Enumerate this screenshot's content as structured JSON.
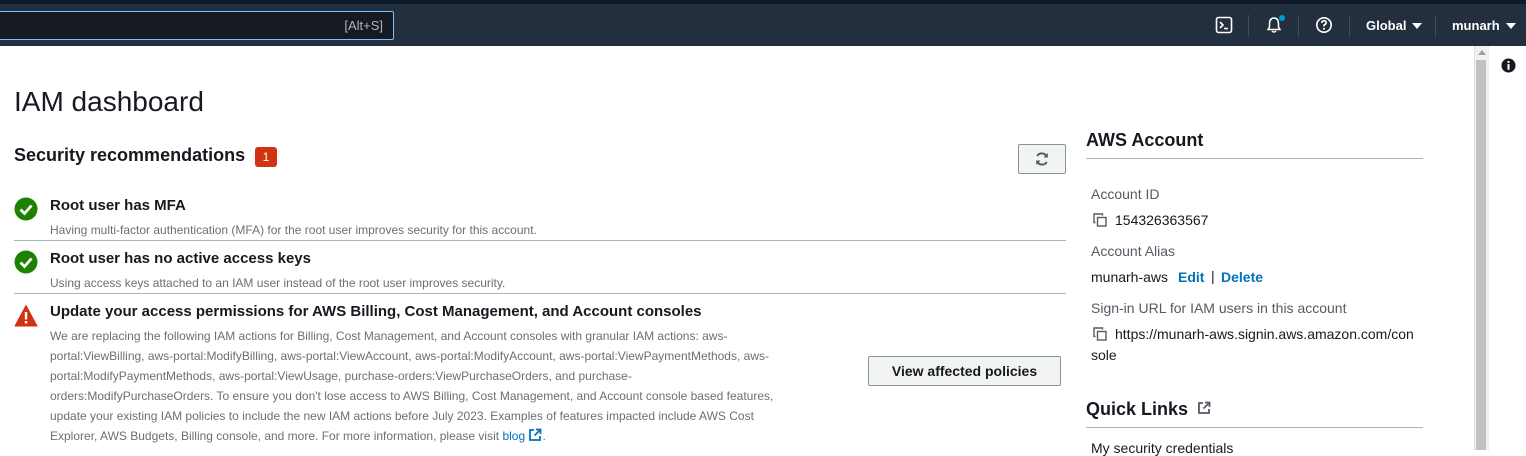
{
  "topnav": {
    "search_shortcut": "[Alt+S]",
    "region": "Global",
    "user": "munarh",
    "icons": [
      "cloudshell-icon",
      "bell-icon",
      "help-icon"
    ]
  },
  "page": {
    "title": "IAM dashboard"
  },
  "security": {
    "title": "Security recommendations",
    "badge_count": "1",
    "items": [
      {
        "status": "success",
        "title": "Root user has MFA",
        "description": "Having multi-factor authentication (MFA) for the root user improves security for this account."
      },
      {
        "status": "success",
        "title": "Root user has no active access keys",
        "description": "Using access keys attached to an IAM user instead of the root user improves security."
      },
      {
        "status": "warning",
        "title": "Update your access permissions for AWS Billing, Cost Management, and Account consoles",
        "description_lines": [
          "We are replacing the following IAM actions for Billing, Cost Management, and Account consoles with granular IAM actions: aws-",
          "portal:ViewBilling, aws-portal:ModifyBilling, aws-portal:ViewAccount, aws-portal:ModifyAccount, aws-portal:ViewPaymentMethods, aws-",
          "portal:ModifyPaymentMethods, aws-portal:ViewUsage, purchase-orders:ViewPurchaseOrders, and purchase-",
          "orders:ModifyPurchaseOrders. To ensure you don't lose access to AWS Billing, Cost Management, and Account console based features,",
          "update your existing IAM policies to include the new IAM actions before July 2023. Examples of features impacted include AWS Cost",
          "Explorer, AWS Budgets, Billing console, and more. For more information, please visit "
        ],
        "link_label": "blog",
        "after_link": ".",
        "button_label": "View affected policies"
      }
    ]
  },
  "account": {
    "title": "AWS Account",
    "account_id_label": "Account ID",
    "account_id": "154326363567",
    "alias_label": "Account Alias",
    "alias": "munarh-aws",
    "edit_label": "Edit",
    "separator": "|",
    "delete_label": "Delete",
    "signin_label": "Sign-in URL for IAM users in this account",
    "signin_url_line1": "https://munarh-aws.signin.aws.amazon.com/con",
    "signin_url_line2": "sole"
  },
  "quick_links": {
    "title": "Quick Links",
    "items": [
      "My security credentials"
    ]
  },
  "colors": {
    "nav_bg": "#232f3e",
    "success": "#1d8102",
    "warning": "#d13212",
    "link": "#0073bb"
  }
}
